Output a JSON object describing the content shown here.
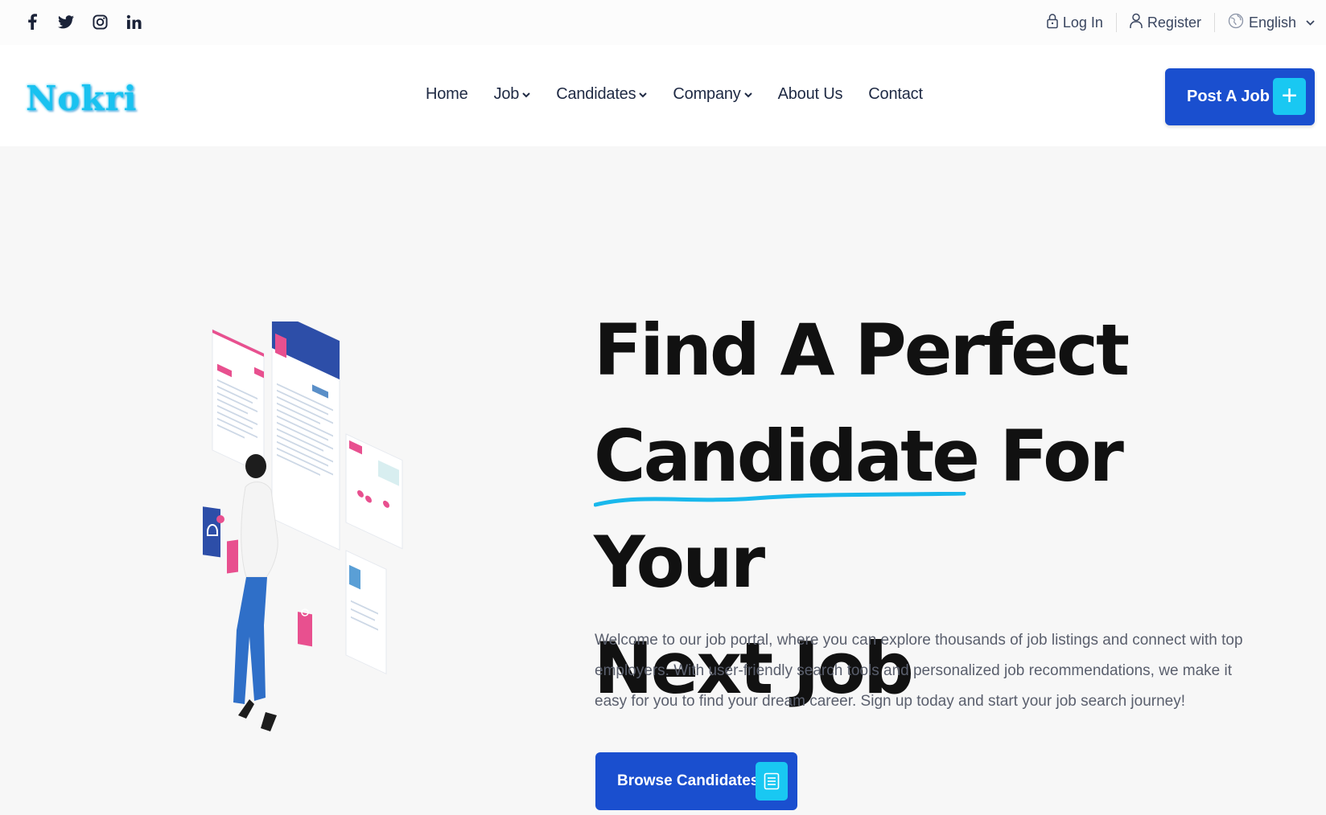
{
  "topbar": {
    "social": [
      {
        "icon": "facebook-icon",
        "glyph": "f"
      },
      {
        "icon": "twitter-icon",
        "glyph": ""
      },
      {
        "icon": "instagram-icon",
        "glyph": ""
      },
      {
        "icon": "linkedin-icon",
        "glyph": "in"
      }
    ],
    "login_label": "Log In",
    "register_label": "Register",
    "language_label": "English"
  },
  "header": {
    "logo_text": "Nokri",
    "nav": [
      {
        "label": "Home",
        "dropdown": false
      },
      {
        "label": "Job",
        "dropdown": true
      },
      {
        "label": "Candidates",
        "dropdown": true
      },
      {
        "label": "Company",
        "dropdown": true
      },
      {
        "label": "About Us",
        "dropdown": false
      },
      {
        "label": "Contact",
        "dropdown": false
      }
    ],
    "post_job_label": "Post A Job",
    "post_job_icon": "+"
  },
  "hero": {
    "title_line1": "Find A Perfect",
    "title_line2": "Candidate For Your",
    "title_line3": "Next Job",
    "description": "Welcome to our job portal, where you can explore thousands of job listings and connect with top employers. With user-friendly search tools and personalized job recommendations, we make it easy for you to find your dream career. Sign up today and start your job search journey!",
    "browse_label": "Browse Candidates"
  },
  "colors": {
    "primary": "#1a4fcf",
    "accent": "#19c8f2",
    "logo": "#19c2f0",
    "text_dark": "#111111",
    "pink": "#e8508f"
  }
}
